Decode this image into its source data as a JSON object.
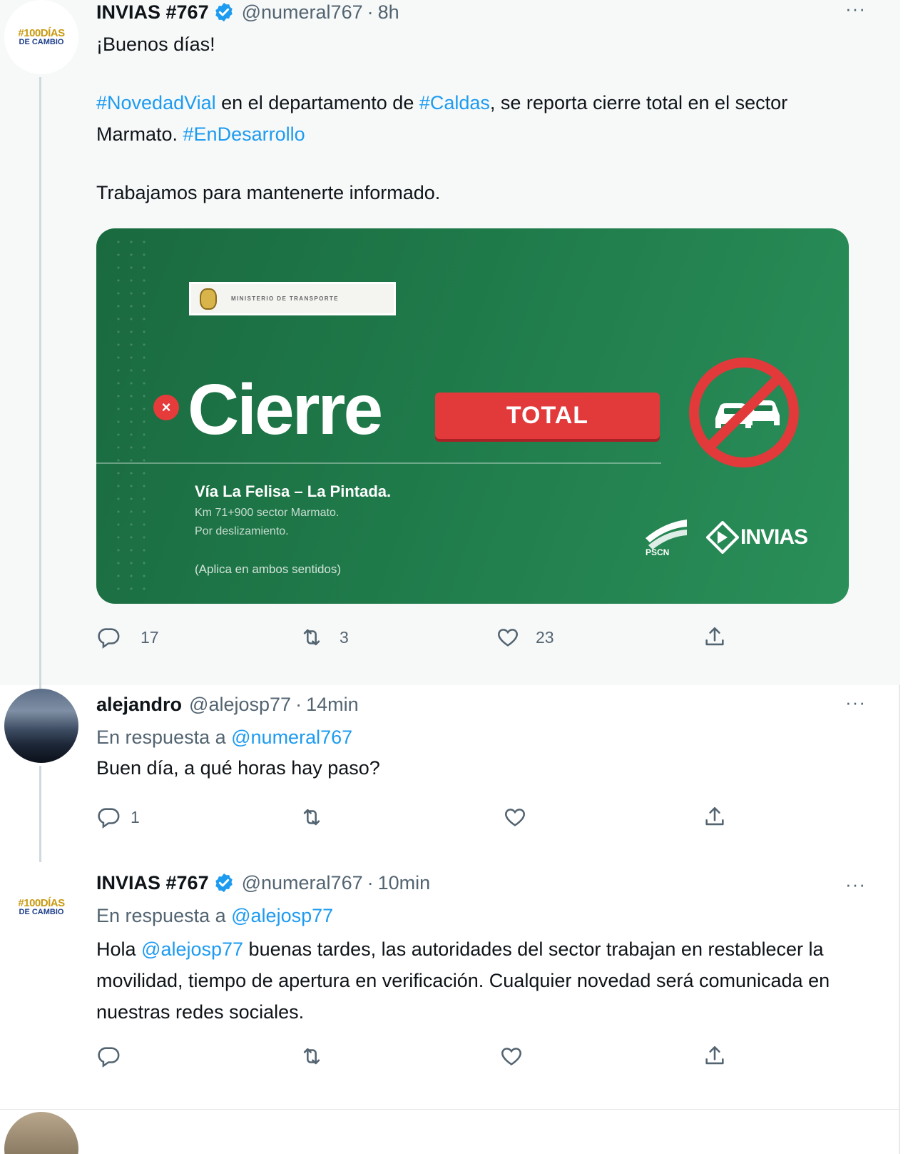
{
  "tweets": [
    {
      "author_name": "INVIAS #767",
      "handle": "@numeral767",
      "time": "8h",
      "avatar_text_1": "#100DÍAS",
      "avatar_text_2": "DE CAMBIO",
      "text_1": "¡Buenos días!",
      "text_2_a": "#NovedadVial",
      "text_2_b": " en el departamento de ",
      "text_2_c": "#Caldas",
      "text_2_d": ", se reporta cierre total en el sector Marmato. ",
      "text_2_e": "#EnDesarrollo",
      "text_3": "Trabajamos para mantenerte informado.",
      "media": {
        "ministry_label": "MINISTERIO DE TRANSPORTE",
        "close_symbol": "×",
        "headline": "Cierre",
        "badge": "TOTAL",
        "route": "Vía La Felisa – La Pintada.",
        "km": "Km 71+900 sector Marmato.",
        "reason": "Por deslizamiento.",
        "note": "(Aplica en ambos sentidos)",
        "pscn_label": "PSCN",
        "invias_label": "INVIAS"
      },
      "replies": "17",
      "retweets": "3",
      "likes": "23"
    },
    {
      "author_name": "alejandro",
      "handle": "@alejosp77",
      "time": "14min",
      "reply_prefix": "En respuesta a ",
      "reply_to": "@numeral767",
      "text": "Buen día, a qué horas hay paso?",
      "replies": "1"
    },
    {
      "author_name": "INVIAS #767",
      "handle": "@numeral767",
      "time": "10min",
      "avatar_text_1": "#100DÍAS",
      "avatar_text_2": "DE CAMBIO",
      "reply_prefix": "En respuesta a ",
      "reply_to": "@alejosp77",
      "text_a": "Hola ",
      "text_b": "@alejosp77",
      "text_c": " buenas tardes, las autoridades del sector trabajan en restablecer la movilidad, tiempo de apertura en verificación. Cualquier novedad será comunicada en nuestras redes sociales."
    }
  ],
  "ui": {
    "separator": "·",
    "more_glyph": "···"
  },
  "colors": {
    "link": "#1d9bf0",
    "verified": "#1d9bf0",
    "media_green": "#1f7a4a",
    "alert_red": "#e2393b"
  }
}
